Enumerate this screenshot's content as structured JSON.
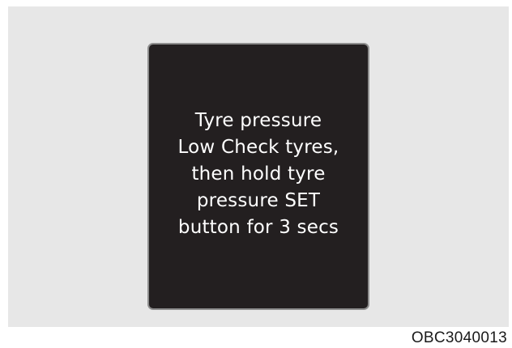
{
  "display": {
    "message_lines": [
      "Tyre pressure",
      "Low Check tyres,",
      "then hold tyre",
      "pressure SET",
      "button for 3 secs"
    ]
  },
  "figure_code": "OBC3040013",
  "colors": {
    "panel_background": "#e7e7e7",
    "display_background": "#231f20",
    "display_text": "#ffffff"
  }
}
